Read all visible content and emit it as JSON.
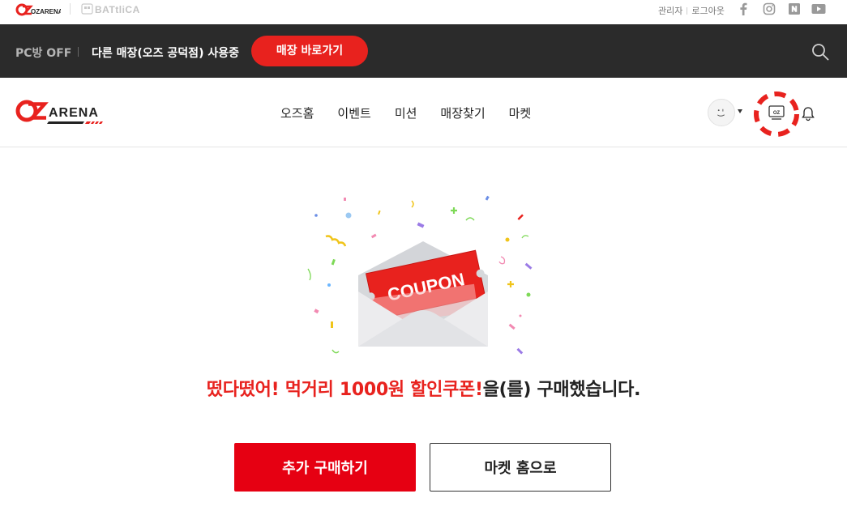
{
  "top_bar": {
    "logo_text": "OZARENA",
    "partner_logo_text": "BATtliCA",
    "links": [
      "관리자",
      "로그아웃"
    ],
    "social_icons": [
      "facebook-icon",
      "instagram-icon",
      "naver-icon",
      "youtube-icon"
    ]
  },
  "status_bar": {
    "pc_status": "PC방 OFF",
    "store_message": "다른 매장(오즈 공덕점) 사용중",
    "store_button": "매장 바로가기"
  },
  "header": {
    "logo_text": "ARENA",
    "nav": [
      "오즈홈",
      "이벤트",
      "미션",
      "매장찾기",
      "마켓"
    ],
    "oz_badge": "OZ"
  },
  "illustration": {
    "coupon_text": "COUPON"
  },
  "message": {
    "highlight": "떴다떴어! 먹거리 1000원 할인쿠폰!",
    "rest": "을(를) 구매했습니다."
  },
  "buttons": {
    "buy_more": "추가 구매하기",
    "market_home": "마켓 홈으로"
  },
  "colors": {
    "accent_red": "#e60012",
    "dark_bar": "#2b2b2b"
  }
}
